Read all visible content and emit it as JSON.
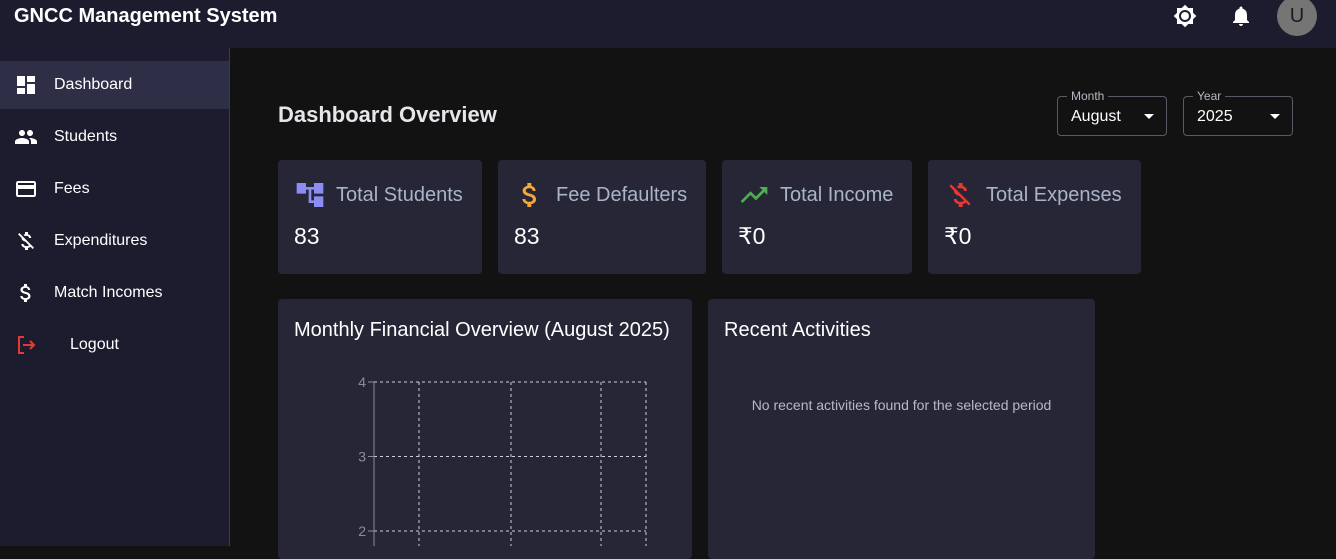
{
  "header": {
    "title": "GNCC Management System",
    "avatar_letter": "U",
    "icons": [
      "brightness-icon",
      "bell-icon"
    ]
  },
  "sidebar": {
    "items": [
      {
        "label": "Dashboard",
        "icon": "dashboard-icon",
        "active": true
      },
      {
        "label": "Students",
        "icon": "people-icon"
      },
      {
        "label": "Fees",
        "icon": "credit-card-icon"
      },
      {
        "label": "Expenditures",
        "icon": "money-off-icon"
      },
      {
        "label": "Match Incomes",
        "icon": "dollar-icon"
      },
      {
        "label": "Logout",
        "icon": "logout-icon",
        "color": "#e53935"
      }
    ]
  },
  "main": {
    "title": "Dashboard Overview",
    "filters": {
      "month": {
        "label": "Month",
        "value": "August"
      },
      "year": {
        "label": "Year",
        "value": "2025"
      }
    },
    "stats": [
      {
        "label": "Total Students",
        "value": "83",
        "icon": "account-tree-icon",
        "color": "#8c8cf2"
      },
      {
        "label": "Fee Defaulters",
        "value": "83",
        "icon": "dollar-icon",
        "color": "#f4a73a"
      },
      {
        "label": "Total Income",
        "value": "₹0",
        "icon": "trending-up-icon",
        "color": "#4caf50"
      },
      {
        "label": "Total Expenses",
        "value": "₹0",
        "icon": "money-off-icon",
        "color": "#e53935"
      }
    ],
    "chart_panel": {
      "title": "Monthly Financial Overview (August 2025)"
    },
    "activities_panel": {
      "title": "Recent Activities",
      "empty_text": "No recent activities found for the selected period"
    }
  },
  "chart_data": {
    "type": "bar",
    "title": "Monthly Financial Overview (August 2025)",
    "y_ticks": [
      "4",
      "3",
      "2"
    ],
    "grid": true
  }
}
